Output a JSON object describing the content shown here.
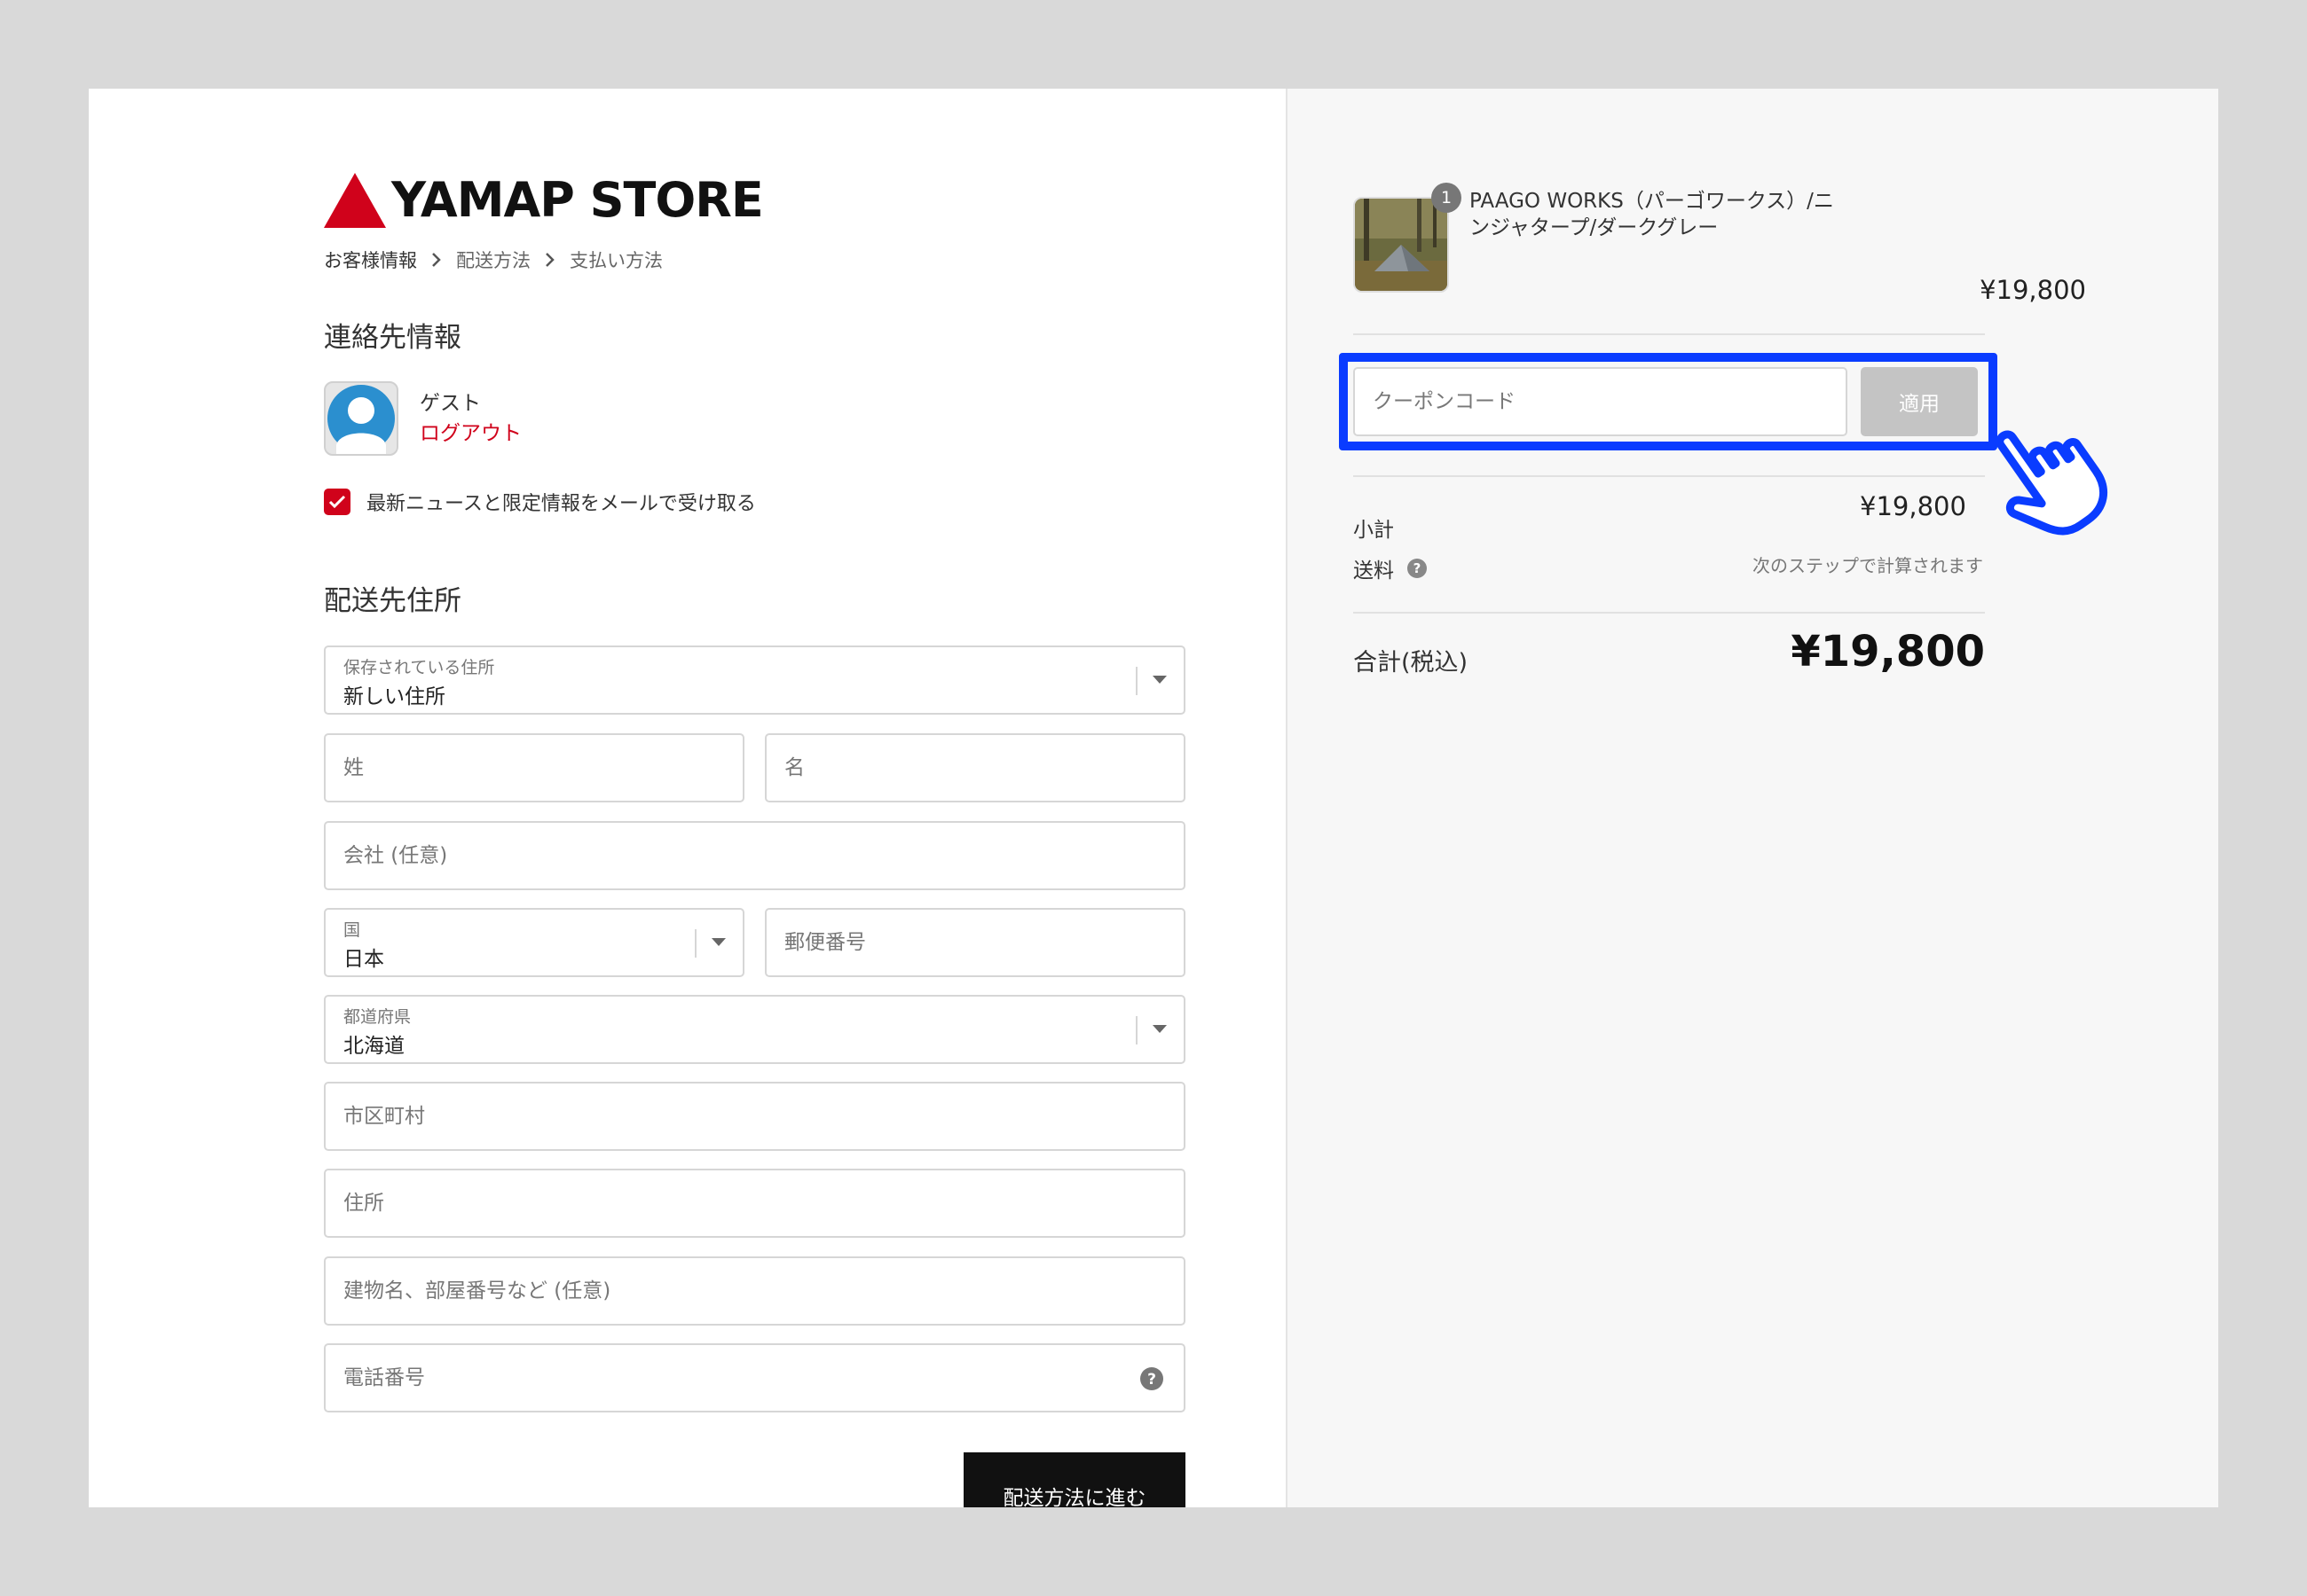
{
  "brand": {
    "name": "YAMAP STORE",
    "logo_color": "#d0021b"
  },
  "breadcrumb": [
    {
      "label": "お客様情報",
      "active": true
    },
    {
      "label": "配送方法",
      "active": false
    },
    {
      "label": "支払い方法",
      "active": false
    }
  ],
  "contact": {
    "title": "連絡先情報",
    "name": "ゲスト",
    "logout_label": "ログアウト",
    "newsletter_label": "最新ニュースと限定情報をメールで受け取る",
    "newsletter_checked": true
  },
  "shipping": {
    "title": "配送先住所",
    "saved_address": {
      "label": "保存されている住所",
      "value": "新しい住所"
    },
    "last_name_placeholder": "姓",
    "first_name_placeholder": "名",
    "company_placeholder": "会社 (任意)",
    "country": {
      "label": "国",
      "value": "日本"
    },
    "postal_placeholder": "郵便番号",
    "prefecture": {
      "label": "都道府県",
      "value": "北海道"
    },
    "city_placeholder": "市区町村",
    "address_placeholder": "住所",
    "building_placeholder": "建物名、部屋番号など (任意)",
    "phone_placeholder": "電話番号",
    "submit_label": "配送方法に進む"
  },
  "summary": {
    "product": {
      "quantity": "1",
      "name": "PAAGO WORKS（パーゴワークス）/ニンジャタープ/ダークグレー",
      "price": "¥19,800"
    },
    "coupon": {
      "placeholder": "クーポンコード",
      "apply_label": "適用"
    },
    "subtotal_label": "小計",
    "subtotal_value": "¥19,800",
    "shipping_label": "送料",
    "shipping_note": "次のステップで計算されます",
    "total_label": "合計(税込)",
    "total_value": "¥19,800"
  },
  "colors": {
    "accent": "#d0021b",
    "highlight": "#0a3cff",
    "button_dark": "#111111"
  },
  "icons": [
    "chevron-right-icon",
    "user-avatar-icon",
    "check-icon",
    "caret-down-icon",
    "help-icon",
    "hand-pointer-icon"
  ]
}
